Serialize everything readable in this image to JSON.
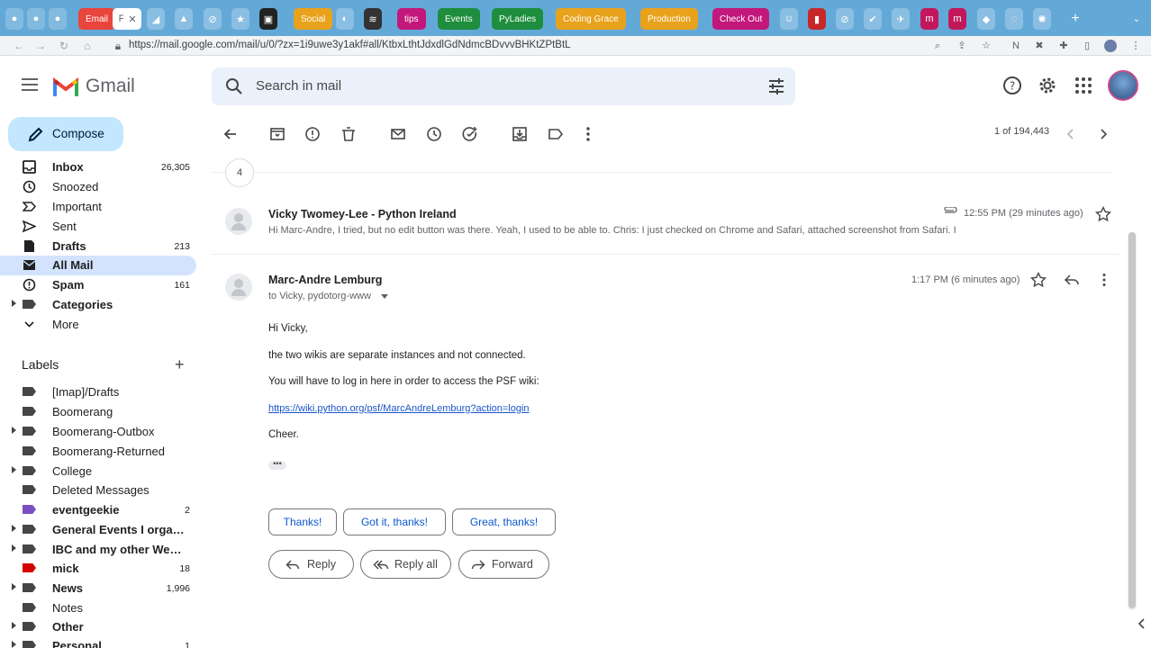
{
  "browser": {
    "tabs": [
      {
        "label": "Email",
        "color": "#e8453c"
      },
      {
        "label": "Social",
        "color": "#e8a21c"
      },
      {
        "label": "tips",
        "color": "#c2187b"
      },
      {
        "label": "Events",
        "color": "#1e8e3e"
      },
      {
        "label": "PyLadies",
        "color": "#1e8e3e"
      },
      {
        "label": "Coding Grace",
        "color": "#e8a21c"
      },
      {
        "label": "Production",
        "color": "#e8a21c"
      },
      {
        "label": "Check Out",
        "color": "#c2187b"
      }
    ],
    "url": "https://mail.google.com/mail/u/0/?zx=1i9uwe3y1akf#all/KtbxLthtJdxdlGdNdmcBDvvvBHKtZPtBtL"
  },
  "header": {
    "app_name": "Gmail",
    "search_placeholder": "Search in mail"
  },
  "sidebar": {
    "compose_label": "Compose",
    "items": [
      {
        "label": "Inbox",
        "count": "26,305",
        "icon": "inbox-icon"
      },
      {
        "label": "Snoozed",
        "count": "",
        "icon": "clock-icon"
      },
      {
        "label": "Important",
        "count": "",
        "icon": "important-icon"
      },
      {
        "label": "Sent",
        "count": "",
        "icon": "send-icon"
      },
      {
        "label": "Drafts",
        "count": "213",
        "icon": "draft-icon"
      },
      {
        "label": "All Mail",
        "count": "",
        "icon": "all-mail-icon"
      },
      {
        "label": "Spam",
        "count": "161",
        "icon": "spam-icon"
      },
      {
        "label": "Categories",
        "count": "",
        "icon": "label-icon"
      },
      {
        "label": "More",
        "count": "",
        "icon": "chevron-down-icon"
      }
    ],
    "labels_heading": "Labels",
    "labels": [
      {
        "label": "[Imap]/Drafts",
        "count": "",
        "color": "#444746"
      },
      {
        "label": "Boomerang",
        "count": "",
        "color": "#444746"
      },
      {
        "label": "Boomerang-Outbox",
        "count": "",
        "color": "#444746"
      },
      {
        "label": "Boomerang-Returned",
        "count": "",
        "color": "#444746"
      },
      {
        "label": "College",
        "count": "",
        "color": "#444746"
      },
      {
        "label": "Deleted Messages",
        "count": "",
        "color": "#444746"
      },
      {
        "label": "eventgeekie",
        "count": "2",
        "color": "#7b4fc4"
      },
      {
        "label": "General Events I organi...",
        "count": "",
        "color": "#444746"
      },
      {
        "label": "IBC and my other Web ...",
        "count": "",
        "color": "#444746"
      },
      {
        "label": "mick",
        "count": "18",
        "color": "#d50000"
      },
      {
        "label": "News",
        "count": "1,996",
        "color": "#444746"
      },
      {
        "label": "Notes",
        "count": "",
        "color": "#444746"
      },
      {
        "label": "Other",
        "count": "",
        "color": "#444746"
      },
      {
        "label": "Personal",
        "count": "1",
        "color": "#444746"
      }
    ]
  },
  "toolbar": {
    "pager": "1 of 194,443"
  },
  "thread": {
    "collapsed_count": "4",
    "messages": [
      {
        "sender": "Vicky Twomey-Lee - Python Ireland",
        "snippet": "Hi Marc-Andre, I tried, but no edit button was there. Yeah, I used to be able to. Chris: I just checked on Chrome and Safari, attached screenshot from Safari. I",
        "time": "12:55 PM (29 minutes ago)"
      },
      {
        "sender": "Marc-Andre Lemburg",
        "to": "to Vicky, pydotorg-www",
        "time": "1:17 PM (6 minutes ago)",
        "body": {
          "greeting": "Hi Vicky,",
          "line1": "the two wikis are separate instances and not connected.",
          "line2": "You will have to log in here in order to access the PSF wiki:",
          "link": "https://wiki.python.org/psf/MarcAndreLemburg?action=login",
          "signoff": "Cheer."
        }
      }
    ],
    "smart_replies": [
      "Thanks!",
      "Got it, thanks!",
      "Great, thanks!"
    ],
    "actions": {
      "reply": "Reply",
      "reply_all": "Reply all",
      "forward": "Forward"
    }
  }
}
